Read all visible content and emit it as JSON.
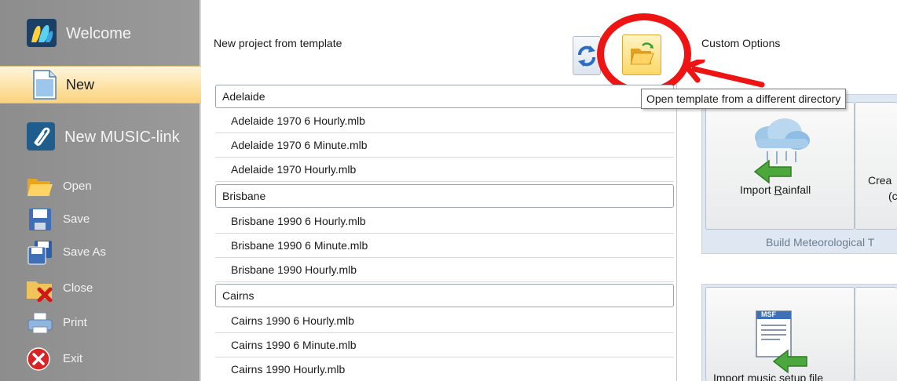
{
  "sidebar": {
    "items": [
      {
        "label": "Welcome",
        "icon": "music-logo-icon"
      },
      {
        "label": "New",
        "icon": "new-document-icon",
        "active": true
      },
      {
        "label": "New MUSIC-link",
        "icon": "music-link-icon"
      },
      {
        "label": "Open",
        "icon": "open-folder-icon"
      },
      {
        "label": "Save",
        "icon": "save-disk-icon"
      },
      {
        "label": "Save As",
        "icon": "save-as-icon"
      },
      {
        "label": "Close",
        "icon": "close-icon"
      },
      {
        "label": "Print",
        "icon": "printer-icon"
      },
      {
        "label": "Exit",
        "icon": "exit-icon"
      }
    ]
  },
  "main": {
    "title": "New project from template",
    "toolbar": {
      "refresh_icon": "refresh-icon",
      "open_icon": "open-template-folder-icon",
      "tooltip": "Open template from a different directory"
    },
    "groups": [
      {
        "name": "Adelaide",
        "items": [
          "Adelaide 1970 6 Hourly.mlb",
          "Adelaide 1970 6 Minute.mlb",
          "Adelaide 1970 Hourly.mlb"
        ]
      },
      {
        "name": "Brisbane",
        "items": [
          "Brisbane 1990 6 Hourly.mlb",
          "Brisbane 1990 6 Minute.mlb",
          "Brisbane 1990 Hourly.mlb"
        ]
      },
      {
        "name": "Cairns",
        "items": [
          "Cairns 1990 6 Hourly.mlb",
          "Cairns 1990 6 Minute.mlb",
          "Cairns 1990 Hourly.mlb"
        ]
      }
    ]
  },
  "custom": {
    "title": "Custom Options",
    "import_rainfall": {
      "prefix": "Import ",
      "mnemonic": "R",
      "suffix": "ainfall"
    },
    "create_label_1": "Crea",
    "create_label_2": "(c",
    "group_caption": "Build Meteorological T",
    "import_music_setup": "Import music setup file",
    "msf_badge": "MSF"
  },
  "colors": {
    "annotation_red": "#ee1414",
    "sidebar_gray": "#929292",
    "active_orange": "#fbd27e",
    "panel_blue": "#dfe8f2"
  }
}
